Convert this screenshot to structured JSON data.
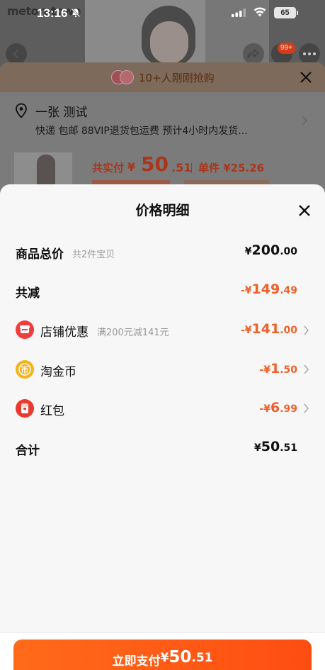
{
  "status_bar": {
    "time": "13:16",
    "battery": "65"
  },
  "background": {
    "logo_text": "metoratowe",
    "cart_badge": "99+",
    "rush_text": "10+人刚刚抢购",
    "address_name": "一张 测试",
    "address_sub": "快递 包邮 88VIP退货包运费 预计4小时内发货...",
    "total_label": "共实付",
    "total_yen": "¥",
    "total_int": "50",
    "total_dec": ".51",
    "unit_price": "单件 ¥25.26"
  },
  "sheet": {
    "title": "价格明细",
    "rows": {
      "goods_total": {
        "label": "商品总价",
        "hint": "共2件宝贝",
        "yen": "¥",
        "int": "200",
        "dec": ".00"
      },
      "total_reduce": {
        "label": "共减",
        "yen": "-¥",
        "int": "149",
        "dec": ".49"
      },
      "shop_discount": {
        "label": "店铺优惠",
        "hint": "满200元减141元",
        "yen": "-¥",
        "int": "141",
        "dec": ".00"
      },
      "tao_coin": {
        "label": "淘金币",
        "yen": "-¥",
        "int": "1",
        "dec": ".50"
      },
      "red_packet": {
        "label": "红包",
        "yen": "-¥",
        "int": "6",
        "dec": ".99"
      },
      "sum": {
        "label": "合计",
        "yen": "¥",
        "int": "50",
        "dec": ".51"
      }
    }
  },
  "pay_button": {
    "label": "立即支付",
    "yen": "¥",
    "int": "50",
    "dec": ".51"
  },
  "colors": {
    "accent": "#ff5a14",
    "discount": "#f0602a",
    "overlay": "#6e6e6e"
  },
  "icons": [
    "bell-slash-icon",
    "signal-icon",
    "wifi-icon",
    "back-arrow-icon",
    "share-icon",
    "cart-icon",
    "more-icon",
    "close-icon",
    "location-pin-icon",
    "chevron-right-icon",
    "shop-icon",
    "coin-icon",
    "red-packet-icon"
  ]
}
